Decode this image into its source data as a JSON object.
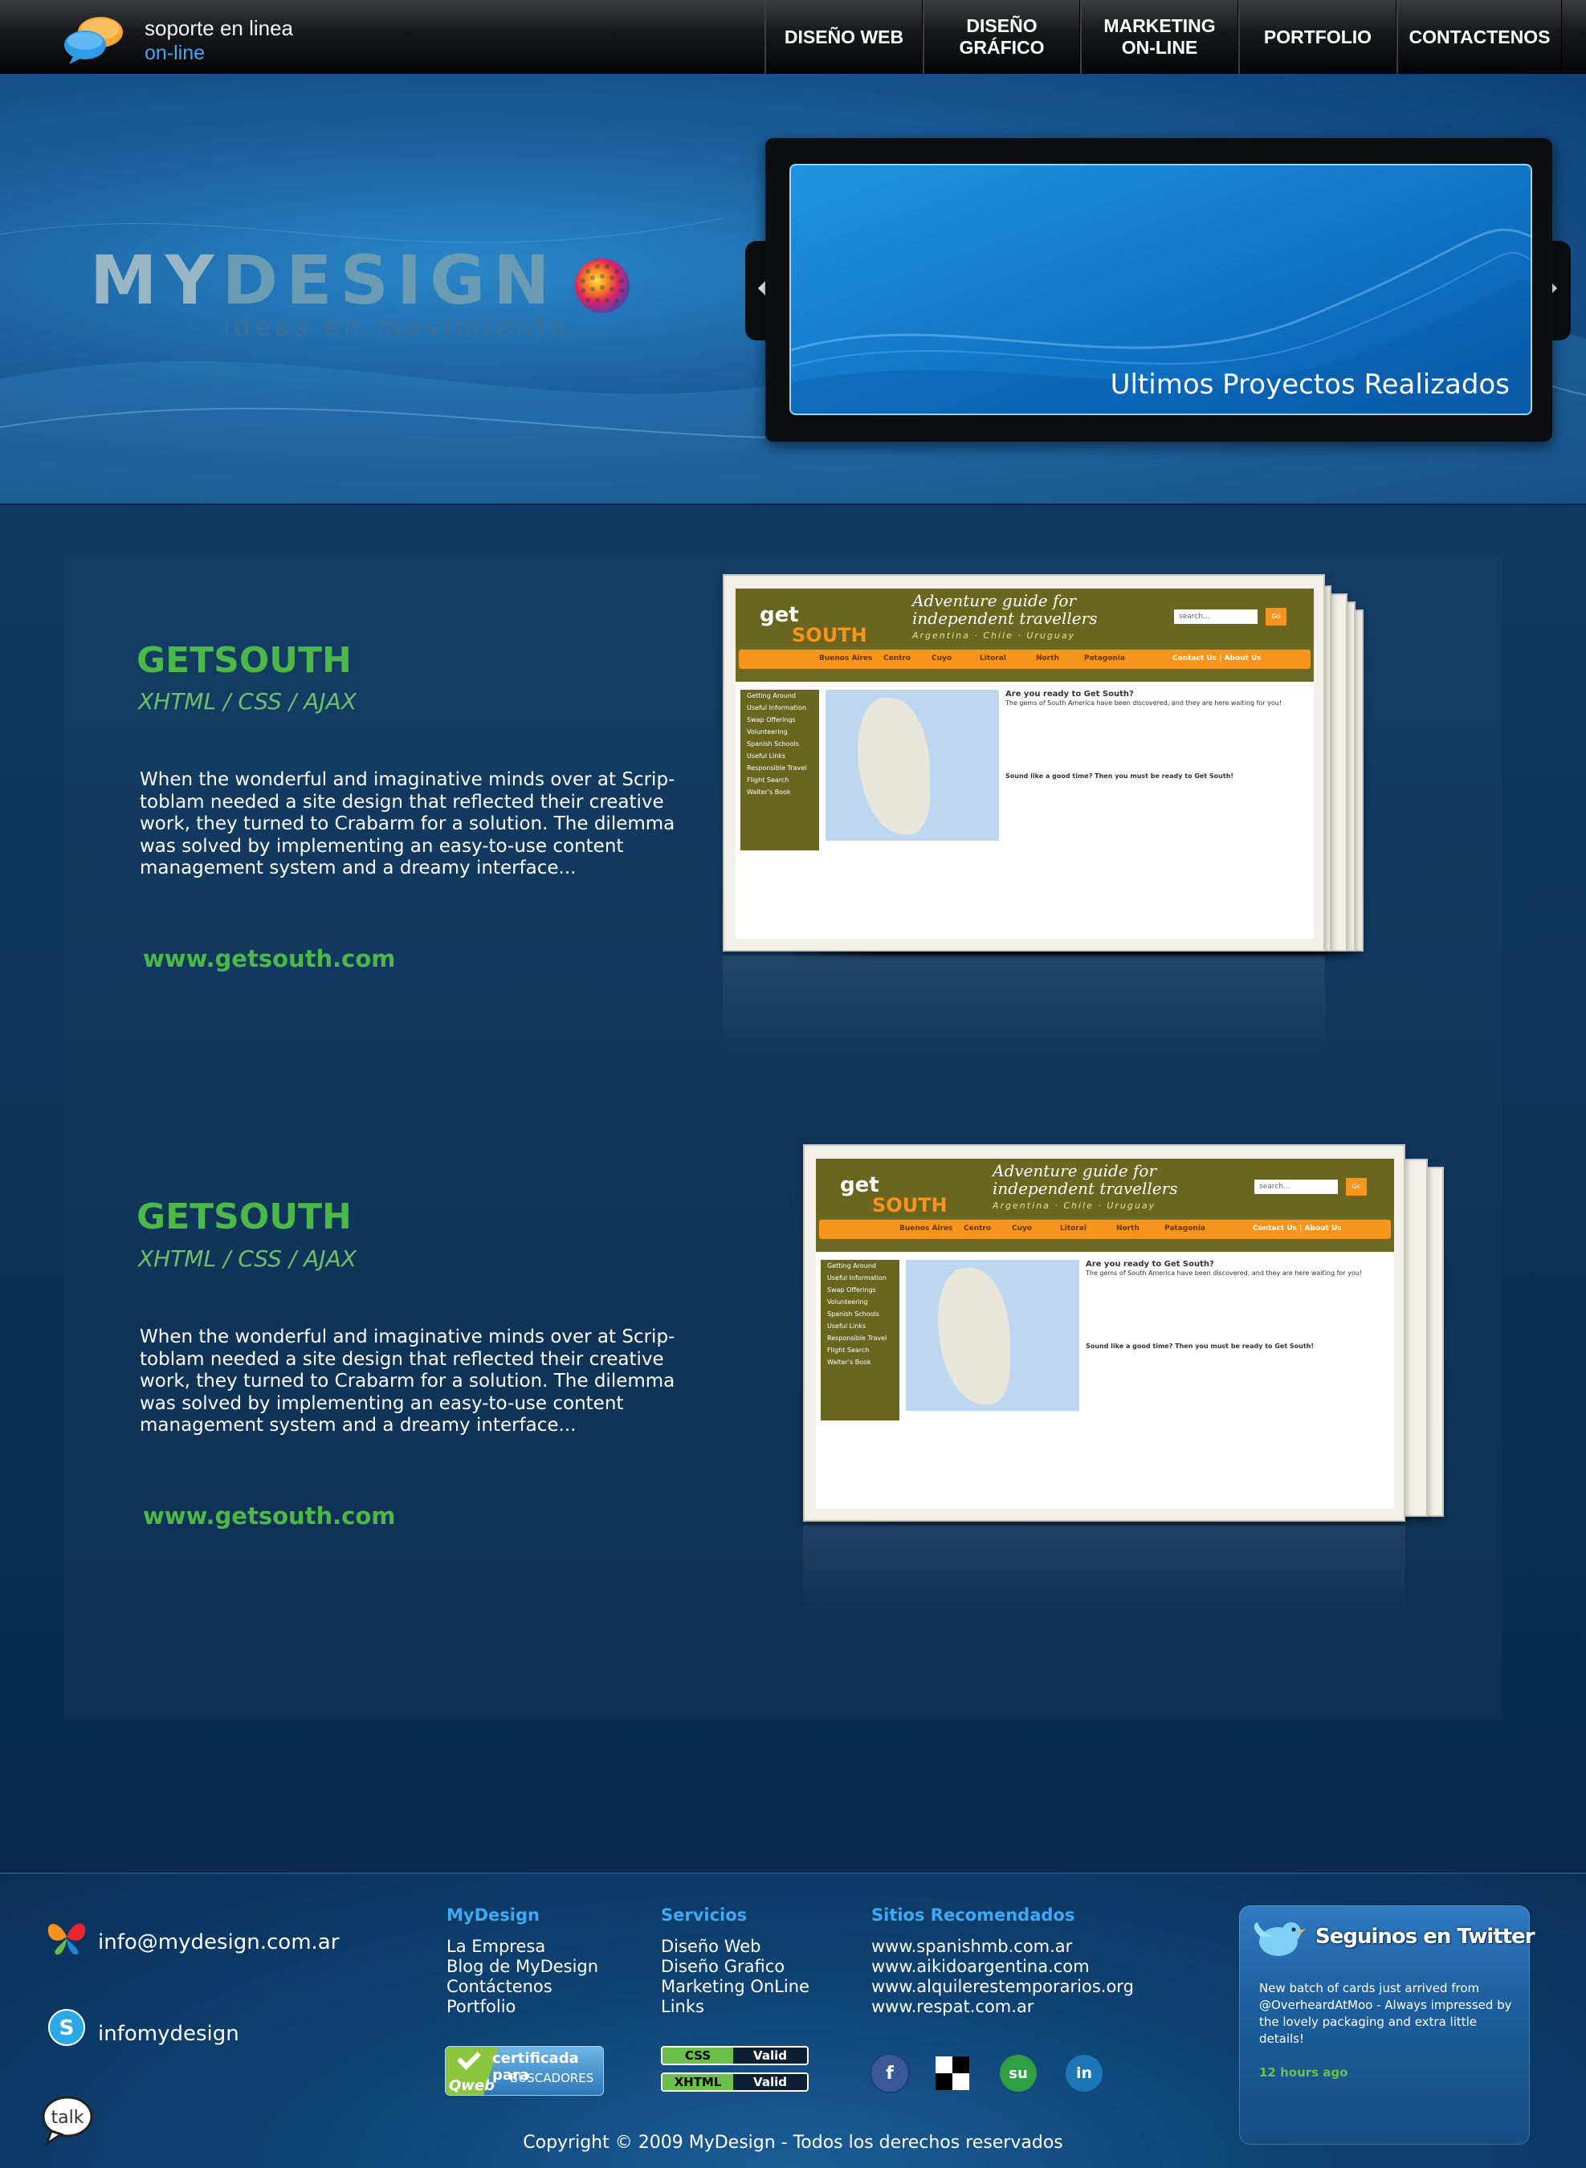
{
  "support": {
    "line1": "soporte en linea",
    "line2": "on-line"
  },
  "nav": [
    {
      "label": "DISEÑO WEB",
      "name": "nav-diseno-web"
    },
    {
      "label": "DISEÑO\nGRÁFICO",
      "name": "nav-diseno-grafico"
    },
    {
      "label": "MARKETING\nON-LINE",
      "name": "nav-marketing-online"
    },
    {
      "label": "PORTFOLIO",
      "name": "nav-portfolio"
    },
    {
      "label": "CONTACTENOS",
      "name": "nav-contactenos"
    }
  ],
  "logo": {
    "part1": "MY",
    "part2": "DESIGN",
    "tagline": "ideas en movimiento"
  },
  "slider": {
    "caption": "Ultimos Proyectos Realizados"
  },
  "projects": [
    {
      "title": "GETSOUTH",
      "subtitle": "XHTML / CSS / AJAX",
      "description": "When the wonderful and imaginative minds over at Scrip-\ntoblam needed a site design that reflected their creative\nwork, they turned to Crabarm for a solution. The dilemma\nwas solved by implementing an easy-to-use content\nmanagement system and a dreamy interface...",
      "link": "www.getsouth.com"
    },
    {
      "title": "GETSOUTH",
      "subtitle": "XHTML / CSS / AJAX",
      "description": "When the wonderful and imaginative minds over at Scrip-\ntoblam needed a site design that reflected their creative\nwork, they turned to Crabarm for a solution. The dilemma\nwas solved by implementing an easy-to-use content\nmanagement system and a dreamy interface...",
      "link": "www.getsouth.com"
    }
  ],
  "preview_site": {
    "logo1": "get",
    "logo2": "SOUTH",
    "tagline": "Adventure guide for independent travellers",
    "countries": "Argentina · Chile · Uruguay",
    "search_placeholder": "search...",
    "go": "Go",
    "nav": [
      "Buenos Aires",
      "Centro",
      "Cuyo",
      "Litoral",
      "North",
      "Patagonia",
      "Contact Us | About Us"
    ],
    "sidebar": [
      "Getting Around",
      "Useful Information",
      "Swap Offerings",
      "Volunteering",
      "Spanish Schools",
      "Useful Links",
      "Responsible Travel",
      "Flight Search",
      "Walter's Book"
    ],
    "heading": "Are you ready to Get South?",
    "body": "The gems of South America have been discovered, and they are here waiting for you!",
    "closing": "Sound like a good time? Then you must be ready to Get South!"
  },
  "footer": {
    "email": "info@mydesign.com.ar",
    "skype": "infomydesign",
    "columns": [
      {
        "heading": "MyDesign",
        "links": [
          "La Empresa",
          "Blog de MyDesign",
          "Contáctenos",
          "Portfolio"
        ]
      },
      {
        "heading": "Servicios",
        "links": [
          "Diseño Web",
          "Diseño Grafico",
          "Marketing OnLine",
          "Links"
        ]
      },
      {
        "heading": "Sitios Recomendados",
        "links": [
          "www.spanishmb.com.ar",
          "www.aikidoargentina.com",
          "www.alquilerestemporarios.org",
          "www.respat.com.ar"
        ]
      }
    ],
    "qweb": {
      "line1": "certificada para",
      "line2": "BUSCADORES",
      "brand": "Qweb"
    },
    "badges": [
      {
        "key": "CSS",
        "value": "Valid"
      },
      {
        "key": "XHTML",
        "value": "Valid"
      }
    ],
    "social": [
      {
        "name": "facebook-icon",
        "glyph": "f",
        "color": "#3b5998"
      },
      {
        "name": "delicious-icon",
        "glyph": "",
        "color": "#ffffff"
      },
      {
        "name": "stumbleupon-icon",
        "glyph": "su",
        "color": "#2ea043"
      },
      {
        "name": "linkedin-icon",
        "glyph": "in",
        "color": "#1c77b6"
      }
    ],
    "twitter": {
      "title": "Seguinos en Twitter",
      "tweet": "New batch of cards just arrived from @OverheardAtMoo - Always impressed by the lovely packaging and extra little details!",
      "time": "12 hours ago"
    },
    "talk": "talk",
    "copyright": "Copyright © 2009 MyDesign - Todos los derechos reservados"
  }
}
